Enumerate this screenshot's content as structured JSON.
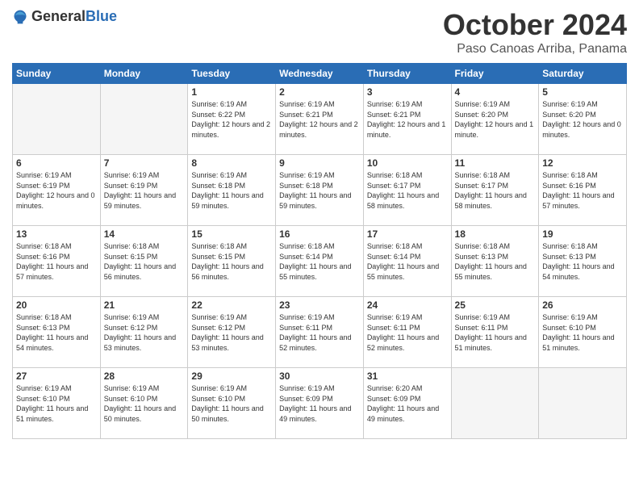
{
  "logo": {
    "general": "General",
    "blue": "Blue"
  },
  "title": "October 2024",
  "location": "Paso Canoas Arriba, Panama",
  "days_of_week": [
    "Sunday",
    "Monday",
    "Tuesday",
    "Wednesday",
    "Thursday",
    "Friday",
    "Saturday"
  ],
  "weeks": [
    [
      {
        "num": "",
        "empty": true
      },
      {
        "num": "",
        "empty": true
      },
      {
        "num": "1",
        "sunrise": "Sunrise: 6:19 AM",
        "sunset": "Sunset: 6:22 PM",
        "daylight": "Daylight: 12 hours and 2 minutes."
      },
      {
        "num": "2",
        "sunrise": "Sunrise: 6:19 AM",
        "sunset": "Sunset: 6:21 PM",
        "daylight": "Daylight: 12 hours and 2 minutes."
      },
      {
        "num": "3",
        "sunrise": "Sunrise: 6:19 AM",
        "sunset": "Sunset: 6:21 PM",
        "daylight": "Daylight: 12 hours and 1 minute."
      },
      {
        "num": "4",
        "sunrise": "Sunrise: 6:19 AM",
        "sunset": "Sunset: 6:20 PM",
        "daylight": "Daylight: 12 hours and 1 minute."
      },
      {
        "num": "5",
        "sunrise": "Sunrise: 6:19 AM",
        "sunset": "Sunset: 6:20 PM",
        "daylight": "Daylight: 12 hours and 0 minutes."
      }
    ],
    [
      {
        "num": "6",
        "sunrise": "Sunrise: 6:19 AM",
        "sunset": "Sunset: 6:19 PM",
        "daylight": "Daylight: 12 hours and 0 minutes."
      },
      {
        "num": "7",
        "sunrise": "Sunrise: 6:19 AM",
        "sunset": "Sunset: 6:19 PM",
        "daylight": "Daylight: 11 hours and 59 minutes."
      },
      {
        "num": "8",
        "sunrise": "Sunrise: 6:19 AM",
        "sunset": "Sunset: 6:18 PM",
        "daylight": "Daylight: 11 hours and 59 minutes."
      },
      {
        "num": "9",
        "sunrise": "Sunrise: 6:19 AM",
        "sunset": "Sunset: 6:18 PM",
        "daylight": "Daylight: 11 hours and 59 minutes."
      },
      {
        "num": "10",
        "sunrise": "Sunrise: 6:18 AM",
        "sunset": "Sunset: 6:17 PM",
        "daylight": "Daylight: 11 hours and 58 minutes."
      },
      {
        "num": "11",
        "sunrise": "Sunrise: 6:18 AM",
        "sunset": "Sunset: 6:17 PM",
        "daylight": "Daylight: 11 hours and 58 minutes."
      },
      {
        "num": "12",
        "sunrise": "Sunrise: 6:18 AM",
        "sunset": "Sunset: 6:16 PM",
        "daylight": "Daylight: 11 hours and 57 minutes."
      }
    ],
    [
      {
        "num": "13",
        "sunrise": "Sunrise: 6:18 AM",
        "sunset": "Sunset: 6:16 PM",
        "daylight": "Daylight: 11 hours and 57 minutes."
      },
      {
        "num": "14",
        "sunrise": "Sunrise: 6:18 AM",
        "sunset": "Sunset: 6:15 PM",
        "daylight": "Daylight: 11 hours and 56 minutes."
      },
      {
        "num": "15",
        "sunrise": "Sunrise: 6:18 AM",
        "sunset": "Sunset: 6:15 PM",
        "daylight": "Daylight: 11 hours and 56 minutes."
      },
      {
        "num": "16",
        "sunrise": "Sunrise: 6:18 AM",
        "sunset": "Sunset: 6:14 PM",
        "daylight": "Daylight: 11 hours and 55 minutes."
      },
      {
        "num": "17",
        "sunrise": "Sunrise: 6:18 AM",
        "sunset": "Sunset: 6:14 PM",
        "daylight": "Daylight: 11 hours and 55 minutes."
      },
      {
        "num": "18",
        "sunrise": "Sunrise: 6:18 AM",
        "sunset": "Sunset: 6:13 PM",
        "daylight": "Daylight: 11 hours and 55 minutes."
      },
      {
        "num": "19",
        "sunrise": "Sunrise: 6:18 AM",
        "sunset": "Sunset: 6:13 PM",
        "daylight": "Daylight: 11 hours and 54 minutes."
      }
    ],
    [
      {
        "num": "20",
        "sunrise": "Sunrise: 6:18 AM",
        "sunset": "Sunset: 6:13 PM",
        "daylight": "Daylight: 11 hours and 54 minutes."
      },
      {
        "num": "21",
        "sunrise": "Sunrise: 6:19 AM",
        "sunset": "Sunset: 6:12 PM",
        "daylight": "Daylight: 11 hours and 53 minutes."
      },
      {
        "num": "22",
        "sunrise": "Sunrise: 6:19 AM",
        "sunset": "Sunset: 6:12 PM",
        "daylight": "Daylight: 11 hours and 53 minutes."
      },
      {
        "num": "23",
        "sunrise": "Sunrise: 6:19 AM",
        "sunset": "Sunset: 6:11 PM",
        "daylight": "Daylight: 11 hours and 52 minutes."
      },
      {
        "num": "24",
        "sunrise": "Sunrise: 6:19 AM",
        "sunset": "Sunset: 6:11 PM",
        "daylight": "Daylight: 11 hours and 52 minutes."
      },
      {
        "num": "25",
        "sunrise": "Sunrise: 6:19 AM",
        "sunset": "Sunset: 6:11 PM",
        "daylight": "Daylight: 11 hours and 51 minutes."
      },
      {
        "num": "26",
        "sunrise": "Sunrise: 6:19 AM",
        "sunset": "Sunset: 6:10 PM",
        "daylight": "Daylight: 11 hours and 51 minutes."
      }
    ],
    [
      {
        "num": "27",
        "sunrise": "Sunrise: 6:19 AM",
        "sunset": "Sunset: 6:10 PM",
        "daylight": "Daylight: 11 hours and 51 minutes."
      },
      {
        "num": "28",
        "sunrise": "Sunrise: 6:19 AM",
        "sunset": "Sunset: 6:10 PM",
        "daylight": "Daylight: 11 hours and 50 minutes."
      },
      {
        "num": "29",
        "sunrise": "Sunrise: 6:19 AM",
        "sunset": "Sunset: 6:10 PM",
        "daylight": "Daylight: 11 hours and 50 minutes."
      },
      {
        "num": "30",
        "sunrise": "Sunrise: 6:19 AM",
        "sunset": "Sunset: 6:09 PM",
        "daylight": "Daylight: 11 hours and 49 minutes."
      },
      {
        "num": "31",
        "sunrise": "Sunrise: 6:20 AM",
        "sunset": "Sunset: 6:09 PM",
        "daylight": "Daylight: 11 hours and 49 minutes."
      },
      {
        "num": "",
        "empty": true
      },
      {
        "num": "",
        "empty": true
      }
    ]
  ]
}
